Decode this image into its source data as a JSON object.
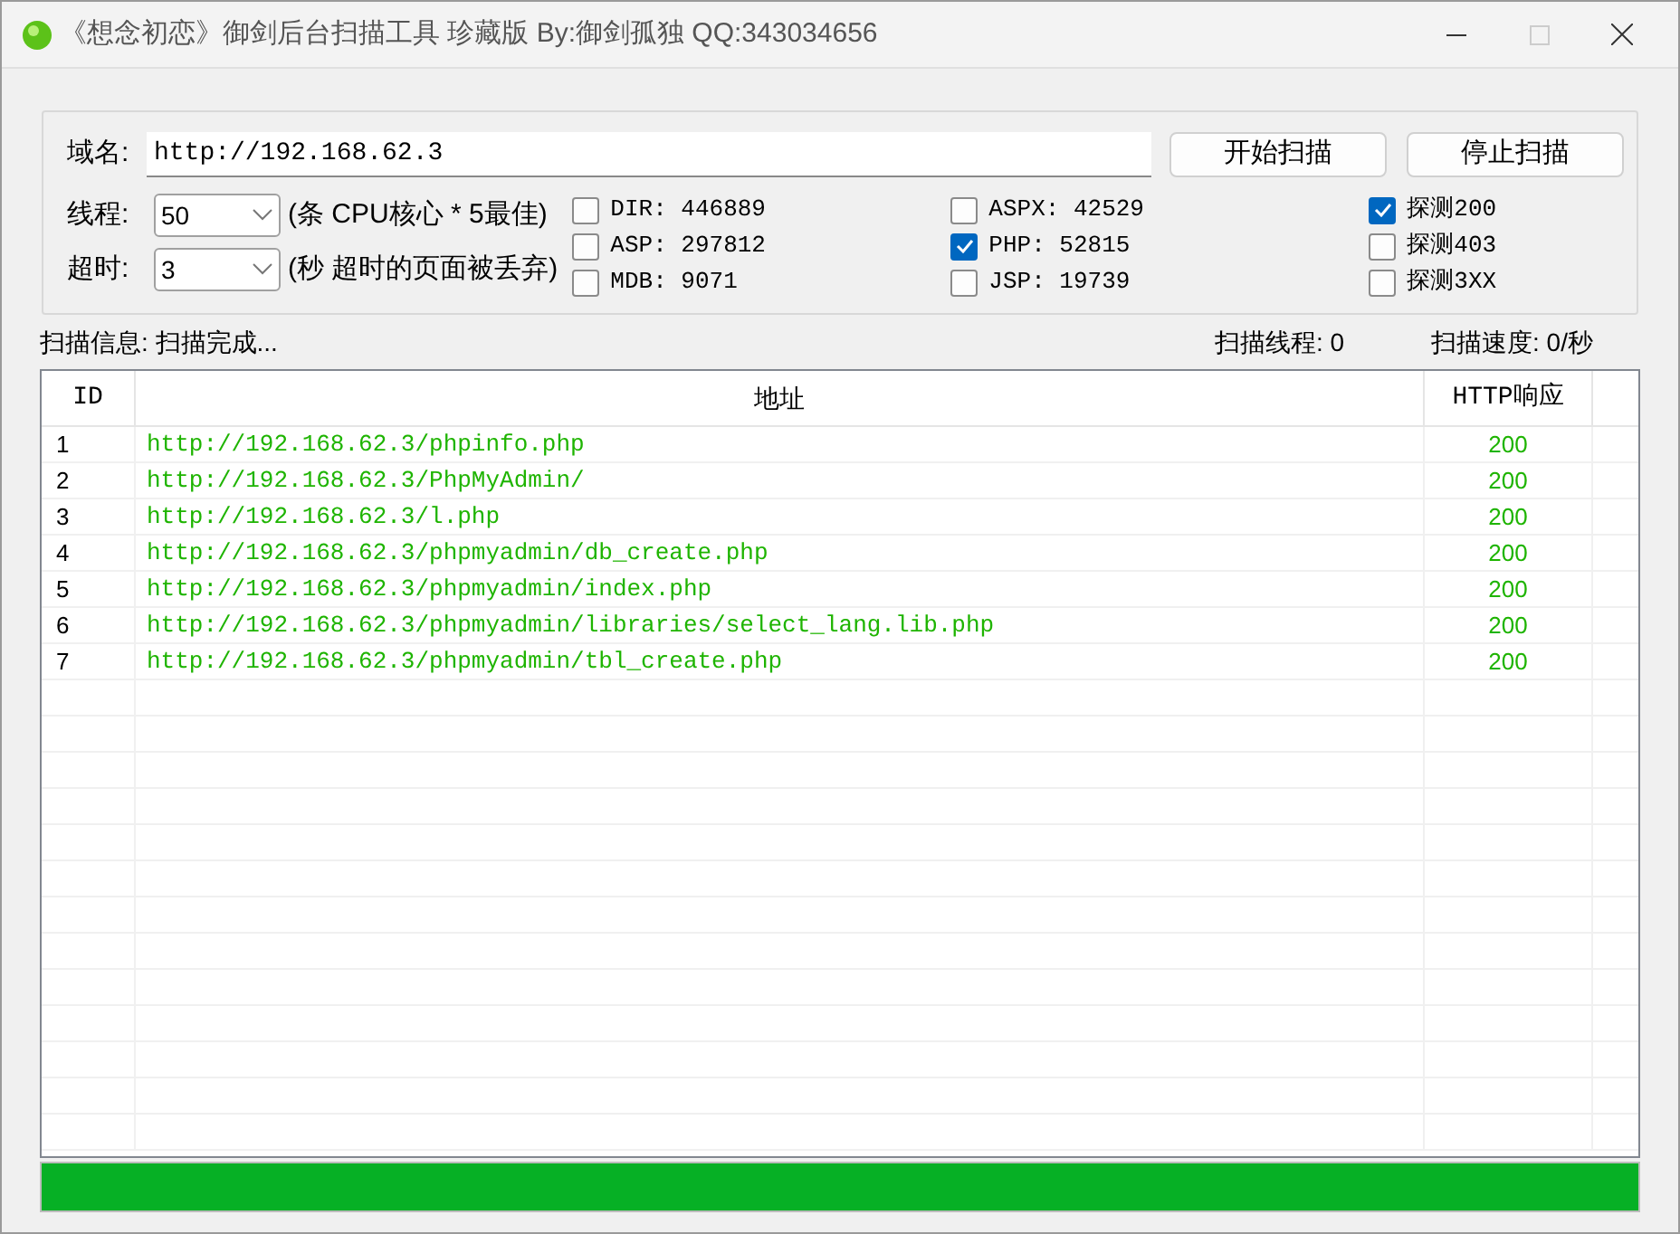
{
  "window": {
    "title": "《想念初恋》御剑后台扫描工具 珍藏版 By:御剑孤独 QQ:343034656"
  },
  "domain": {
    "label": "域名:",
    "value": "http://192.168.62.3"
  },
  "buttons": [
    "开始扫描",
    "停止扫描"
  ],
  "threads": {
    "label": "线程:",
    "value": "50",
    "hint": "(条 CPU核心 * 5最佳)"
  },
  "timeout": {
    "label": "超时:",
    "value": "3",
    "hint": "(秒 超时的页面被丢弃)"
  },
  "dictionaries": [
    [
      {
        "label": "DIR: 446889",
        "checked": false
      },
      {
        "label": "ASP: 297812",
        "checked": false
      },
      {
        "label": "MDB: 9071",
        "checked": false
      }
    ],
    [
      {
        "label": "ASPX: 42529",
        "checked": false
      },
      {
        "label": "PHP: 52815",
        "checked": true
      },
      {
        "label": "JSP: 19739",
        "checked": false
      }
    ]
  ],
  "detect": [
    {
      "label": "探测200",
      "checked": true
    },
    {
      "label": "探测403",
      "checked": false
    },
    {
      "label": "探测3XX",
      "checked": false
    }
  ],
  "status": {
    "info": "扫描信息: 扫描完成...",
    "threads": "扫描线程: 0",
    "speed": "扫描速度: 0/秒"
  },
  "table": {
    "columns": [
      "ID",
      "地址",
      "HTTP响应"
    ],
    "rows": [
      [
        "1",
        "http://192.168.62.3/phpinfo.php",
        "200"
      ],
      [
        "2",
        "http://192.168.62.3/PhpMyAdmin/",
        "200"
      ],
      [
        "3",
        "http://192.168.62.3/l.php",
        "200"
      ],
      [
        "4",
        "http://192.168.62.3/phpmyadmin/db_create.php",
        "200"
      ],
      [
        "5",
        "http://192.168.62.3/phpmyadmin/index.php",
        "200"
      ],
      [
        "6",
        "http://192.168.62.3/phpmyadmin/libraries/select_lang.lib.php",
        "200"
      ],
      [
        "7",
        "http://192.168.62.3/phpmyadmin/tbl_create.php",
        "200"
      ]
    ]
  },
  "progress": {
    "level": 1
  }
}
